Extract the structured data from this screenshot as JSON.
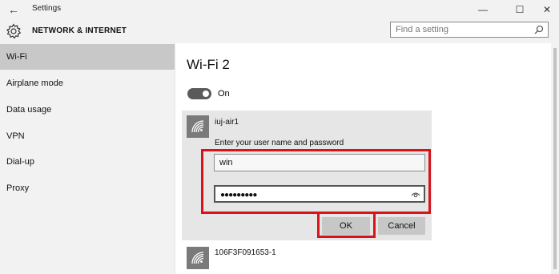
{
  "window": {
    "title": "Settings",
    "back_glyph": "←",
    "minimize_glyph": "—",
    "maximize_glyph": "☐",
    "close_glyph": "✕"
  },
  "header": {
    "section_title": "NETWORK & INTERNET",
    "gear_icon": "gear-icon"
  },
  "search": {
    "placeholder": "Find a setting",
    "value": ""
  },
  "sidebar": {
    "items": [
      {
        "label": "Wi-Fi",
        "active": true
      },
      {
        "label": "Airplane mode",
        "active": false
      },
      {
        "label": "Data usage",
        "active": false
      },
      {
        "label": "VPN",
        "active": false
      },
      {
        "label": "Dial-up",
        "active": false
      },
      {
        "label": "Proxy",
        "active": false
      }
    ]
  },
  "main": {
    "title": "Wi-Fi 2",
    "toggle_label": "On",
    "toggle_state": true,
    "networks": [
      {
        "name": "iuj-air1",
        "prompt": "Enter your user name and password",
        "username_value": "win",
        "password_value": "●●●●●●●●●",
        "ok_label": "OK",
        "cancel_label": "Cancel"
      },
      {
        "name": "106F3F091653-1"
      }
    ]
  },
  "colors": {
    "highlight": "#d8131a",
    "sidebar_bg": "#f2f2f2",
    "active_item": "#c8c8c8",
    "toggle_on": "#5a5a5a"
  }
}
